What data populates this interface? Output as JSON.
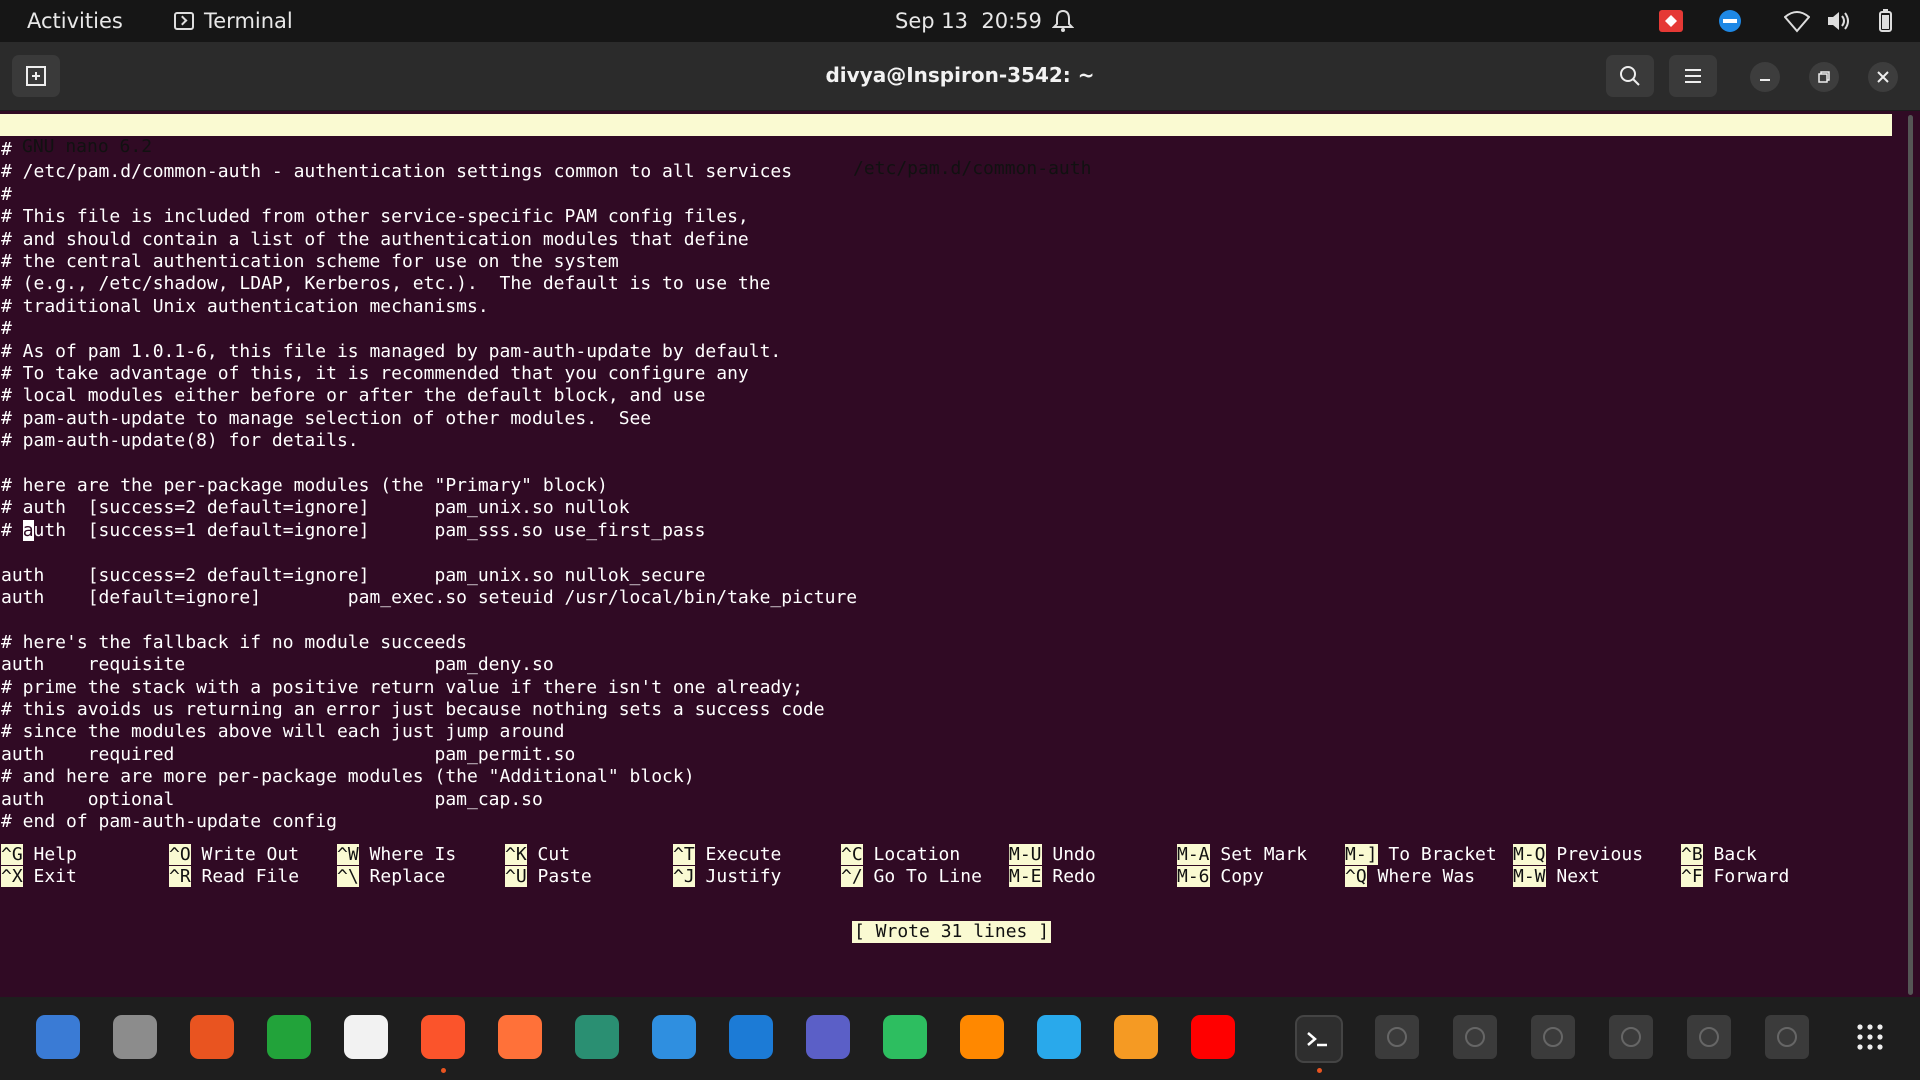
{
  "topbar": {
    "activities": "Activities",
    "app_name": "Terminal",
    "date": "Sep 13",
    "time": "20:59"
  },
  "window": {
    "title": "divya@Inspiron-3542: ~"
  },
  "nano": {
    "version": "GNU nano 6.2",
    "filename": "/etc/pam.d/common-auth",
    "status": "[ Wrote 31 lines ]",
    "lines": [
      "#",
      "# /etc/pam.d/common-auth - authentication settings common to all services",
      "#",
      "# This file is included from other service-specific PAM config files,",
      "# and should contain a list of the authentication modules that define",
      "# the central authentication scheme for use on the system",
      "# (e.g., /etc/shadow, LDAP, Kerberos, etc.).  The default is to use the",
      "# traditional Unix authentication mechanisms.",
      "#",
      "# As of pam 1.0.1-6, this file is managed by pam-auth-update by default.",
      "# To take advantage of this, it is recommended that you configure any",
      "# local modules either before or after the default block, and use",
      "# pam-auth-update to manage selection of other modules.  See",
      "# pam-auth-update(8) for details.",
      "",
      "# here are the per-package modules (the \"Primary\" block)",
      "# auth  [success=2 default=ignore]      pam_unix.so nullok",
      "# auth  [success=1 default=ignore]      pam_sss.so use_first_pass",
      "",
      "auth    [success=2 default=ignore]      pam_unix.so nullok_secure",
      "auth    [default=ignore]        pam_exec.so seteuid /usr/local/bin/take_picture",
      "",
      "# here's the fallback if no module succeeds",
      "auth    requisite                       pam_deny.so",
      "# prime the stack with a positive return value if there isn't one already;",
      "# this avoids us returning an error just because nothing sets a success code",
      "# since the modules above will each just jump around",
      "auth    required                        pam_permit.so",
      "# and here are more per-package modules (the \"Additional\" block)",
      "auth    optional                        pam_cap.so",
      "# end of pam-auth-update config"
    ],
    "shortcuts": [
      {
        "k1": "^G",
        "l1": "Help",
        "k2": "^X",
        "l2": "Exit"
      },
      {
        "k1": "^O",
        "l1": "Write Out",
        "k2": "^R",
        "l2": "Read File"
      },
      {
        "k1": "^W",
        "l1": "Where Is",
        "k2": "^\\",
        "l2": "Replace"
      },
      {
        "k1": "^K",
        "l1": "Cut",
        "k2": "^U",
        "l2": "Paste"
      },
      {
        "k1": "^T",
        "l1": "Execute",
        "k2": "^J",
        "l2": "Justify"
      },
      {
        "k1": "^C",
        "l1": "Location",
        "k2": "^/",
        "l2": "Go To Line"
      },
      {
        "k1": "M-U",
        "l1": "Undo",
        "k2": "M-E",
        "l2": "Redo"
      },
      {
        "k1": "M-A",
        "l1": "Set Mark",
        "k2": "M-6",
        "l2": "Copy"
      },
      {
        "k1": "M-]",
        "l1": "To Bracket",
        "k2": "^Q",
        "l2": "Where Was"
      },
      {
        "k1": "M-Q",
        "l1": "Previous",
        "k2": "M-W",
        "l2": "Next"
      },
      {
        "k1": "^B",
        "l1": "Back",
        "k2": "^F",
        "l2": "Forward"
      }
    ]
  },
  "dock": {
    "apps": [
      {
        "name": "thunderbird-icon",
        "color": "#3a7bd5"
      },
      {
        "name": "files-icon",
        "color": "#8c8c8c"
      },
      {
        "name": "app-center-icon",
        "color": "#e95420"
      },
      {
        "name": "spreadsheet-icon",
        "color": "#22a33a"
      },
      {
        "name": "text-editor-icon",
        "color": "#f2f2f2"
      },
      {
        "name": "brave-icon",
        "color": "#fb542b"
      },
      {
        "name": "firefox-icon",
        "color": "#ff7139"
      },
      {
        "name": "document-viewer-icon",
        "color": "#2a8f72"
      },
      {
        "name": "blank-window-icon",
        "color": "#2f8fe0"
      },
      {
        "name": "pycharm-icon",
        "color": "#1c7bd6"
      },
      {
        "name": "teams-icon",
        "color": "#5b5fc7"
      },
      {
        "name": "evernote-icon",
        "color": "#2dbe60"
      },
      {
        "name": "vlc-icon",
        "color": "#ff8800"
      },
      {
        "name": "telegram-icon",
        "color": "#29a9eb"
      },
      {
        "name": "sun-app-icon",
        "color": "#f59a23"
      },
      {
        "name": "youtube-icon",
        "color": "#ff0000"
      }
    ]
  }
}
